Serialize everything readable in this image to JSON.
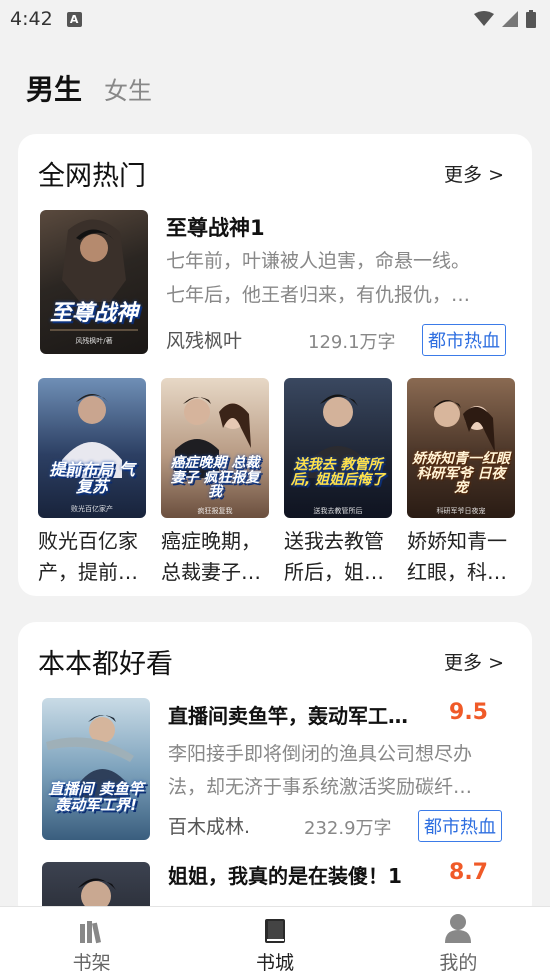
{
  "status_bar": {
    "time": "4:42"
  },
  "gender_tabs": {
    "male": "男生",
    "female": "女生"
  },
  "hot_section": {
    "title": "全网热门",
    "more": "更多 >",
    "featured": {
      "title": "至尊战神1",
      "desc_lines": [
        "七年前，叶谦被人迫害，命悬一线。",
        "七年后，他王者归来，有仇报仇，…"
      ],
      "author": "风残枫叶",
      "words": "129.1万字",
      "tag": "都市热血",
      "cover_text": "至尊战神",
      "cover_sub": "风残枫叶/著"
    },
    "grid": [
      {
        "title_lines": [
          "败光百亿家",
          "产，提前…"
        ],
        "cover_text": "提前布局 气复苏",
        "cover_sub": "败光百亿家产"
      },
      {
        "title_lines": [
          "癌症晚期，",
          "总裁妻子…"
        ],
        "cover_text": "癌症晚期 总裁妻子 疯狂报复我",
        "cover_sub": "疯狂报复我"
      },
      {
        "title_lines": [
          "送我去教管",
          "所后，姐…"
        ],
        "cover_text": "送我去 教管所后, 姐姐后悔了",
        "cover_sub": "送我去教管所后"
      },
      {
        "title_lines": [
          "娇娇知青一",
          "红眼，科…"
        ],
        "cover_text": "娇娇知青一红眼 科研军爷 日夜宠",
        "cover_sub": "科研军爷日夜宠"
      }
    ]
  },
  "good_section": {
    "title": "本本都好看",
    "more": "更多 >",
    "items": [
      {
        "title": "直播间卖鱼竿，轰动军工…",
        "score": "9.5",
        "desc_lines": [
          "李阳接手即将倒闭的渔具公司想尽办",
          "法，却无济于事系统激活奖励碳纤…"
        ],
        "author": "百木成林.",
        "words": "232.9万字",
        "tag": "都市热血",
        "cover_text": "直播间 卖鱼竿 轰动军工界!"
      },
      {
        "title": "姐姐，我真的是在装傻！1",
        "score": "8.7"
      }
    ]
  },
  "bottom_nav": {
    "shelf": "书架",
    "store": "书城",
    "mine": "我的"
  }
}
